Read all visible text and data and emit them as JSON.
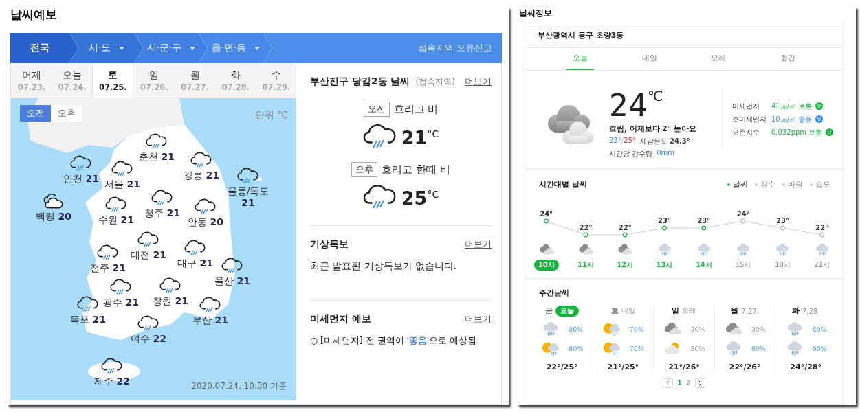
{
  "left": {
    "title": "날씨예보",
    "nav": [
      {
        "label": "전국",
        "selected": true,
        "dropdown": false
      },
      {
        "label": "시·도",
        "selected": false,
        "dropdown": true
      },
      {
        "label": "시·군·구",
        "selected": false,
        "dropdown": true
      },
      {
        "label": "읍·면·동",
        "selected": false,
        "dropdown": true
      }
    ],
    "report_link": "접속지역 오류신고",
    "days": [
      {
        "day": "어제",
        "date": "07.23.",
        "selected": false
      },
      {
        "day": "오늘",
        "date": "07.24.",
        "selected": false
      },
      {
        "day": "토",
        "date": "07.25.",
        "selected": true
      },
      {
        "day": "일",
        "date": "07.26.",
        "selected": false
      },
      {
        "day": "월",
        "date": "07.27.",
        "selected": false
      },
      {
        "day": "화",
        "date": "07.28.",
        "selected": false
      },
      {
        "day": "수",
        "date": "07.29.",
        "selected": false
      }
    ],
    "map": {
      "periods": [
        {
          "label": "오전",
          "selected": true
        },
        {
          "label": "오후",
          "selected": false
        }
      ],
      "unit": "단위 ℃",
      "timestamp": "2020.07.24. 10:30 기준",
      "cities": [
        {
          "name": "춘천",
          "temp": "21",
          "kind": "rain"
        },
        {
          "name": "인천",
          "temp": "21",
          "kind": "rain"
        },
        {
          "name": "서울",
          "temp": "21",
          "kind": "rain"
        },
        {
          "name": "강릉",
          "temp": "21",
          "kind": "rain"
        },
        {
          "name": "울릉/독도",
          "temp": "21",
          "kind": "rain"
        },
        {
          "name": "백령",
          "temp": "20",
          "kind": "cloud"
        },
        {
          "name": "수원",
          "temp": "21",
          "kind": "rain"
        },
        {
          "name": "청주",
          "temp": "21",
          "kind": "rain"
        },
        {
          "name": "안동",
          "temp": "20",
          "kind": "rain"
        },
        {
          "name": "대전",
          "temp": "21",
          "kind": "rain"
        },
        {
          "name": "전주",
          "temp": "21",
          "kind": "rain"
        },
        {
          "name": "대구",
          "temp": "21",
          "kind": "rain"
        },
        {
          "name": "울산",
          "temp": "21",
          "kind": "rain"
        },
        {
          "name": "광주",
          "temp": "21",
          "kind": "rain"
        },
        {
          "name": "창원",
          "temp": "21",
          "kind": "rain"
        },
        {
          "name": "목포",
          "temp": "21",
          "kind": "rain"
        },
        {
          "name": "부산",
          "temp": "21",
          "kind": "rain"
        },
        {
          "name": "여수",
          "temp": "22",
          "kind": "rain"
        },
        {
          "name": "제주",
          "temp": "22",
          "kind": "rain"
        }
      ]
    },
    "local": {
      "title": "부산진구 당감2동 날씨",
      "note": "(접속지역)",
      "more": "더보기",
      "forecasts": [
        {
          "period": "오전",
          "summary": "흐리고 비",
          "kind": "rain",
          "temp": "21",
          "unit": "°C"
        },
        {
          "period": "오후",
          "summary": "흐리고 한때 비",
          "kind": "rain",
          "temp": "25",
          "unit": "°C"
        }
      ]
    },
    "alerts": {
      "title": "기상특보",
      "more": "더보기",
      "text": "최근 발표된 기상특보가 없습니다."
    },
    "dust": {
      "title": "미세먼지 예보",
      "more": "더보기",
      "text_before": "○ [미세먼지] 전 권역이 ",
      "highlight": "'좋음'",
      "text_after": "으로 예상됨."
    }
  },
  "right": {
    "title": "날씨정보",
    "location": "부산광역시 동구 초량3동",
    "tabs": [
      {
        "label": "오늘",
        "selected": true
      },
      {
        "label": "내일",
        "selected": false
      },
      {
        "label": "모레",
        "selected": false
      },
      {
        "label": "월간",
        "selected": false
      }
    ],
    "current": {
      "kind": "cloud",
      "temp": "24",
      "unit": "℃",
      "summary": "흐림, 어제보다 2° 높아요",
      "low": "22°",
      "range_separator": "/",
      "high": "25°",
      "feels": "체감온도 **24.3°**",
      "rain_label": "시간당 강수량",
      "rain": "0mm",
      "air": [
        {
          "label": "미세먼지",
          "value": "41㎍/㎥ 보통",
          "color": "#1bb544",
          "kind": "neutral"
        },
        {
          "label": "초미세먼지",
          "value": "10㎍/㎥ 좋음",
          "color": "#3d8ee6",
          "kind": "smile"
        },
        {
          "label": "오존지수",
          "value": "0.032ppm 보통",
          "color": "#1bb544",
          "kind": "neutral"
        }
      ]
    },
    "hourly": {
      "title": "시간대별 날씨",
      "legend": [
        {
          "label": "날씨",
          "selected": true
        },
        {
          "label": "강수",
          "selected": false
        },
        {
          "label": "바람",
          "selected": false
        },
        {
          "label": "습도",
          "selected": false
        }
      ],
      "chart_data": {
        "type": "line",
        "marker": "circle",
        "categories": [
          "10시",
          "11시",
          "12시",
          "13시",
          "14시",
          "15시",
          "18시",
          "21시"
        ],
        "values": [
          24,
          22,
          22,
          23,
          23,
          24,
          23,
          22
        ],
        "value_labels": [
          "24°",
          "22°",
          "22°",
          "23°",
          "23°",
          "24°",
          "23°",
          "22°"
        ]
      },
      "hours": [
        {
          "kind": "cloud",
          "selected": true,
          "highlighted": true
        },
        {
          "kind": "cloud",
          "selected": false,
          "highlighted": true
        },
        {
          "kind": "cloud",
          "selected": false,
          "highlighted": true
        },
        {
          "kind": "rain",
          "selected": false,
          "highlighted": true
        },
        {
          "kind": "rain",
          "selected": false,
          "highlighted": true
        },
        {
          "kind": "rain",
          "selected": false,
          "highlighted": false
        },
        {
          "kind": "rain",
          "selected": false,
          "highlighted": false
        },
        {
          "kind": "rain",
          "selected": false,
          "highlighted": false
        }
      ]
    },
    "weekly": {
      "title": "주간날씨",
      "days": [
        {
          "day": "금",
          "tag": "오늘",
          "today": true,
          "am": {
            "kind": "rain",
            "chance": "80%"
          },
          "pm": {
            "kind": "sun-rain",
            "chance": "80%"
          },
          "temps": "22°/25°"
        },
        {
          "day": "토",
          "tag": "내일",
          "today": false,
          "am": {
            "kind": "sun-rain",
            "chance": "70%"
          },
          "pm": {
            "kind": "sun-rain",
            "chance": "70%"
          },
          "temps": "21°/25°"
        },
        {
          "day": "일",
          "tag": "모레",
          "today": false,
          "am": {
            "kind": "cloud",
            "chance": "30%"
          },
          "pm": {
            "kind": "sun-cloud",
            "chance": "30%"
          },
          "temps": "21°/26°"
        },
        {
          "day": "월",
          "tag": "7.27.",
          "today": false,
          "am": {
            "kind": "cloud",
            "chance": "30%"
          },
          "pm": {
            "kind": "rain",
            "chance": "60%"
          },
          "temps": "22°/26°"
        },
        {
          "day": "화",
          "tag": "7.28.",
          "today": false,
          "am": {
            "kind": "rain",
            "chance": "60%"
          },
          "pm": {
            "kind": "rain",
            "chance": "60%"
          },
          "temps": "24°/28°"
        }
      ],
      "pages": [
        {
          "label": "1",
          "selected": true
        },
        {
          "label": "2",
          "selected": false
        }
      ]
    }
  }
}
